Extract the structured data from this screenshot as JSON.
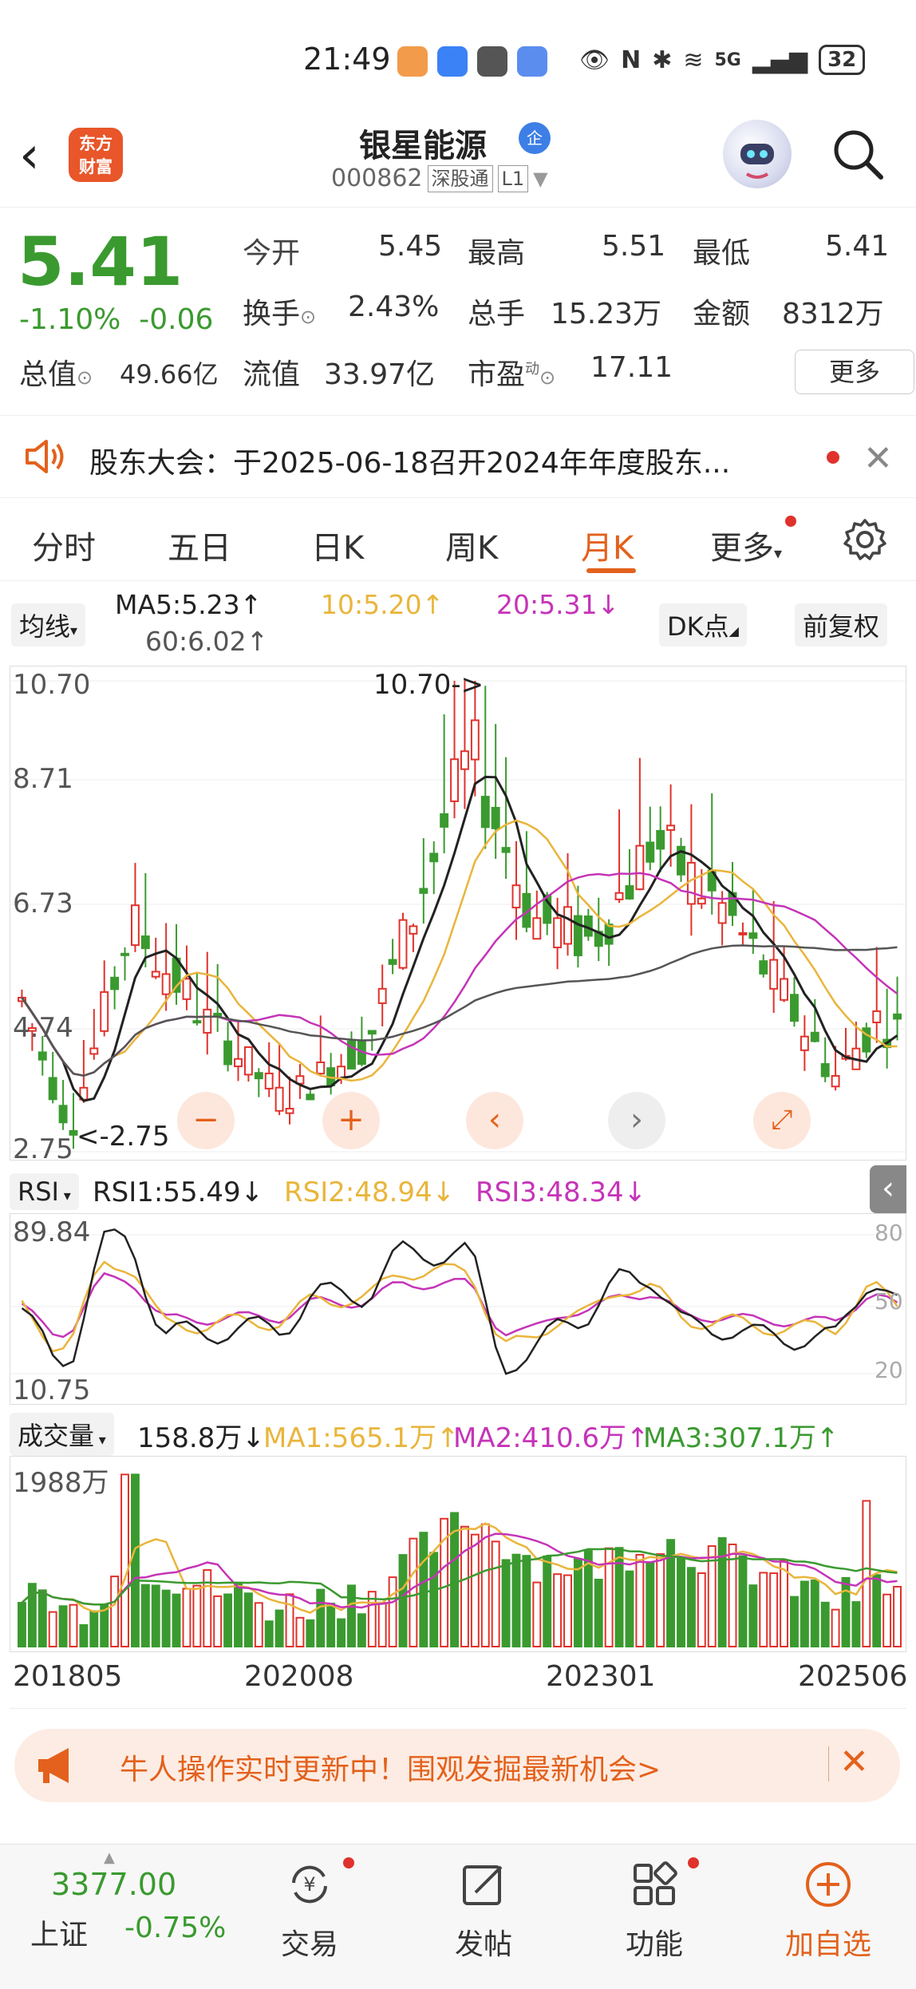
{
  "status_bar": {
    "time": "21:49",
    "network": "5G",
    "battery": "32"
  },
  "header": {
    "logo_line1": "东方",
    "logo_line2": "财富",
    "stock_name": "银星能源",
    "badge": "企",
    "code": "000862",
    "market_tag": "深股通",
    "level_tag": "L1"
  },
  "quote": {
    "price": "5.41",
    "change_pct": "-1.10%",
    "change": "-0.06",
    "open_label": "今开",
    "open": "5.45",
    "high_label": "最高",
    "high": "5.51",
    "low_label": "最低",
    "low": "5.41",
    "turnover_label": "换手",
    "turnover": "2.43%",
    "volume_label": "总手",
    "volume": "15.23万",
    "amount_label": "金额",
    "amount": "8312万",
    "mktcap_label": "总值",
    "mktcap": "49.66亿",
    "float_label": "流值",
    "float": "33.97亿",
    "pe_label": "市盈",
    "pe_sup": "动",
    "pe": "17.11",
    "more": "更多"
  },
  "notice": {
    "text": "股东大会：于2025-06-18召开2024年年度股东..."
  },
  "tabs": {
    "t1": "分时",
    "t2": "五日",
    "t3": "日K",
    "t4": "周K",
    "t5": "月K",
    "t6": "更多"
  },
  "ma_bar": {
    "selector": "均线",
    "ma5": "MA5:5.23↑",
    "ma10": "10:5.20↑",
    "ma20": "20:5.31↓",
    "ma60": "60:6.02↑",
    "dk": "DK点",
    "fq": "前复权"
  },
  "kline": {
    "y_labels": [
      "10.70",
      "8.71",
      "6.73",
      "4.74",
      "2.75"
    ],
    "max_note": "10.70->",
    "min_note": "<-2.75",
    "controls": {
      "minus": "−",
      "plus": "+",
      "left": "‹",
      "right": "›"
    }
  },
  "rsi_bar": {
    "selector": "RSI",
    "rsi1": "RSI1:55.49↓",
    "rsi2": "RSI2:48.94↓",
    "rsi3": "RSI3:48.34↓",
    "y_top": "89.84",
    "y_bot": "10.75",
    "r80": "80",
    "r50": "50",
    "r20": "20"
  },
  "vol_bar": {
    "selector": "成交量",
    "vol": "158.8万↓",
    "ma1": "MA1:565.1万↑",
    "ma2": "MA2:410.6万↑",
    "ma3": "MA3:307.1万↑",
    "y_top": "1988万"
  },
  "x_axis": [
    "201805",
    "202008",
    "202301",
    "202506"
  ],
  "banner": {
    "text": "牛人操作实时更新中！围观发掘最新机会>"
  },
  "bottom_nav": {
    "index_value": "3377.00",
    "index_name": "上证",
    "index_change": "-0.75%",
    "trade": "交易",
    "post": "发帖",
    "func": "功能",
    "add": "加自选"
  },
  "colors": {
    "up": "#e0322c",
    "down": "#3a9a2f",
    "accent": "#e3611c",
    "ma5": "#222222",
    "ma10": "#e9b53b",
    "ma20": "#c534b8",
    "ma60": "#555555"
  }
}
